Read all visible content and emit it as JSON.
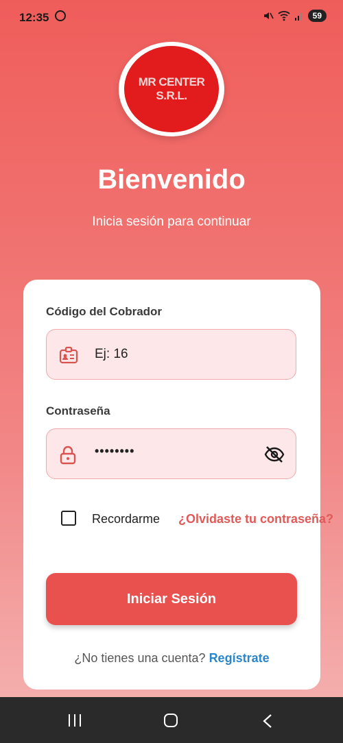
{
  "status_bar": {
    "time": "12:35",
    "battery": "59"
  },
  "logo": {
    "line1": "MR CENTER",
    "line2": "S.R.L."
  },
  "header": {
    "title": "Bienvenido",
    "subtitle": "Inicia sesión para continuar"
  },
  "form": {
    "code_label": "Código del Cobrador",
    "code_placeholder": "Ej: 16",
    "password_label": "Contraseña",
    "password_value": "••••••••",
    "remember_label": "Recordarme",
    "forgot_link": "¿Olvidaste tu contraseña?",
    "submit_label": "Iniciar Sesión"
  },
  "signup": {
    "prompt": "¿No tienes una cuenta?",
    "link": "Regístrate"
  },
  "colors": {
    "accent": "#e9514e",
    "link": "#2b86c9",
    "field_bg": "#fde7e8"
  }
}
